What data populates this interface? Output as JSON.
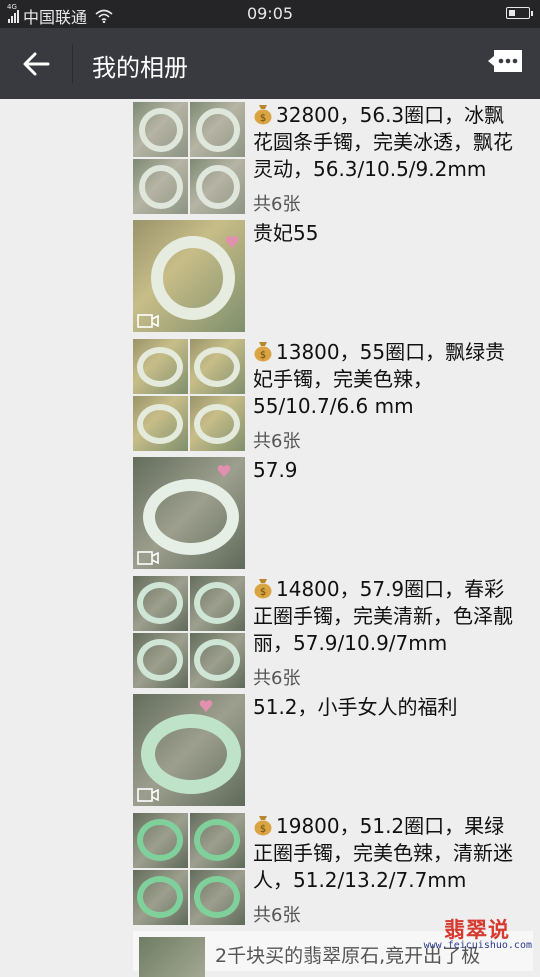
{
  "status_bar": {
    "signal_tag": "4G",
    "carrier": "中国联通",
    "time": "09:05",
    "battery_level": 0.35
  },
  "header": {
    "back_icon": "arrow-left-icon",
    "title": "我的相册",
    "more_icon": "comment-more-icon"
  },
  "posts": [
    {
      "type": "grid",
      "caption": "32800，56.3圈口，冰飘花圆条手镯，完美冰透，飘花灵动，56.3/10.5/9.2mm",
      "count": "共6张",
      "icon": "money-bag-icon"
    },
    {
      "type": "video",
      "caption": "贵妃55"
    },
    {
      "type": "grid",
      "caption": "13800，55圈口，飘绿贵妃手镯，完美色辣，55/10.7/6.6 mm",
      "count": "共6张",
      "icon": "money-bag-icon"
    },
    {
      "type": "video",
      "caption": "57.9"
    },
    {
      "type": "grid",
      "caption": "14800，57.9圈口，春彩正圈手镯，完美清新，色泽靓丽，57.9/10.9/7mm",
      "count": "共6张",
      "icon": "money-bag-icon"
    },
    {
      "type": "video",
      "caption": "51.2，小手女人的福利"
    },
    {
      "type": "grid",
      "caption": "19800，51.2圈口，果绿正圈手镯，完美色辣，清新迷人，51.2/13.2/7.7mm",
      "count": "共6张",
      "icon": "money-bag-icon"
    }
  ],
  "shared_card": {
    "text": "2千块买的翡翠原石,竟开出了极"
  },
  "watermark": {
    "title": "翡翠说",
    "url": "www.feicuishuo.com"
  }
}
